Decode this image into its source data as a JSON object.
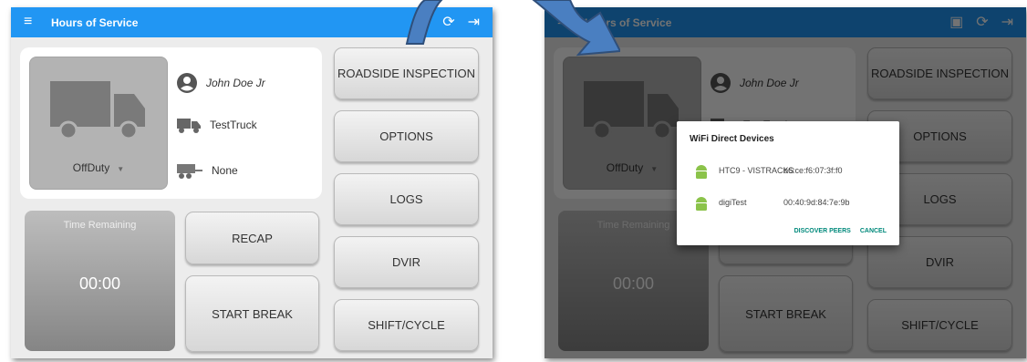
{
  "app": {
    "title": "Hours of Service",
    "bar_color": "#2196f3"
  },
  "driver": {
    "name": "John Doe Jr"
  },
  "vehicle": {
    "truck": "TestTruck",
    "trailer": "None",
    "status": "OffDuty"
  },
  "buttons": {
    "roadside": "ROADSIDE INSPECTION",
    "options": "OPTIONS",
    "logs": "LOGS",
    "dvir": "DVIR",
    "shift": "SHIFT/CYCLE",
    "recap": "RECAP",
    "start_break": "START BREAK"
  },
  "time_remaining": {
    "label": "Time Remaining",
    "value": "00:00"
  },
  "dialog": {
    "title": "WiFi Direct Devices",
    "devices": [
      {
        "name": "HTC9 - VISTRACKS",
        "mac": "b6:ce:f6:07:3f:f0"
      },
      {
        "name": "digiTest",
        "mac": "00:40:9d:84:7e:9b"
      }
    ],
    "discover": "DISCOVER PEERS",
    "cancel": "CANCEL"
  },
  "icons": {
    "menu": "hamburger-icon",
    "sync": "sync-icon",
    "logout": "logout-icon",
    "device": "device-icon",
    "android": "android-icon"
  },
  "colors": {
    "arrow": "#4a7fc1",
    "accent": "#00897b"
  }
}
